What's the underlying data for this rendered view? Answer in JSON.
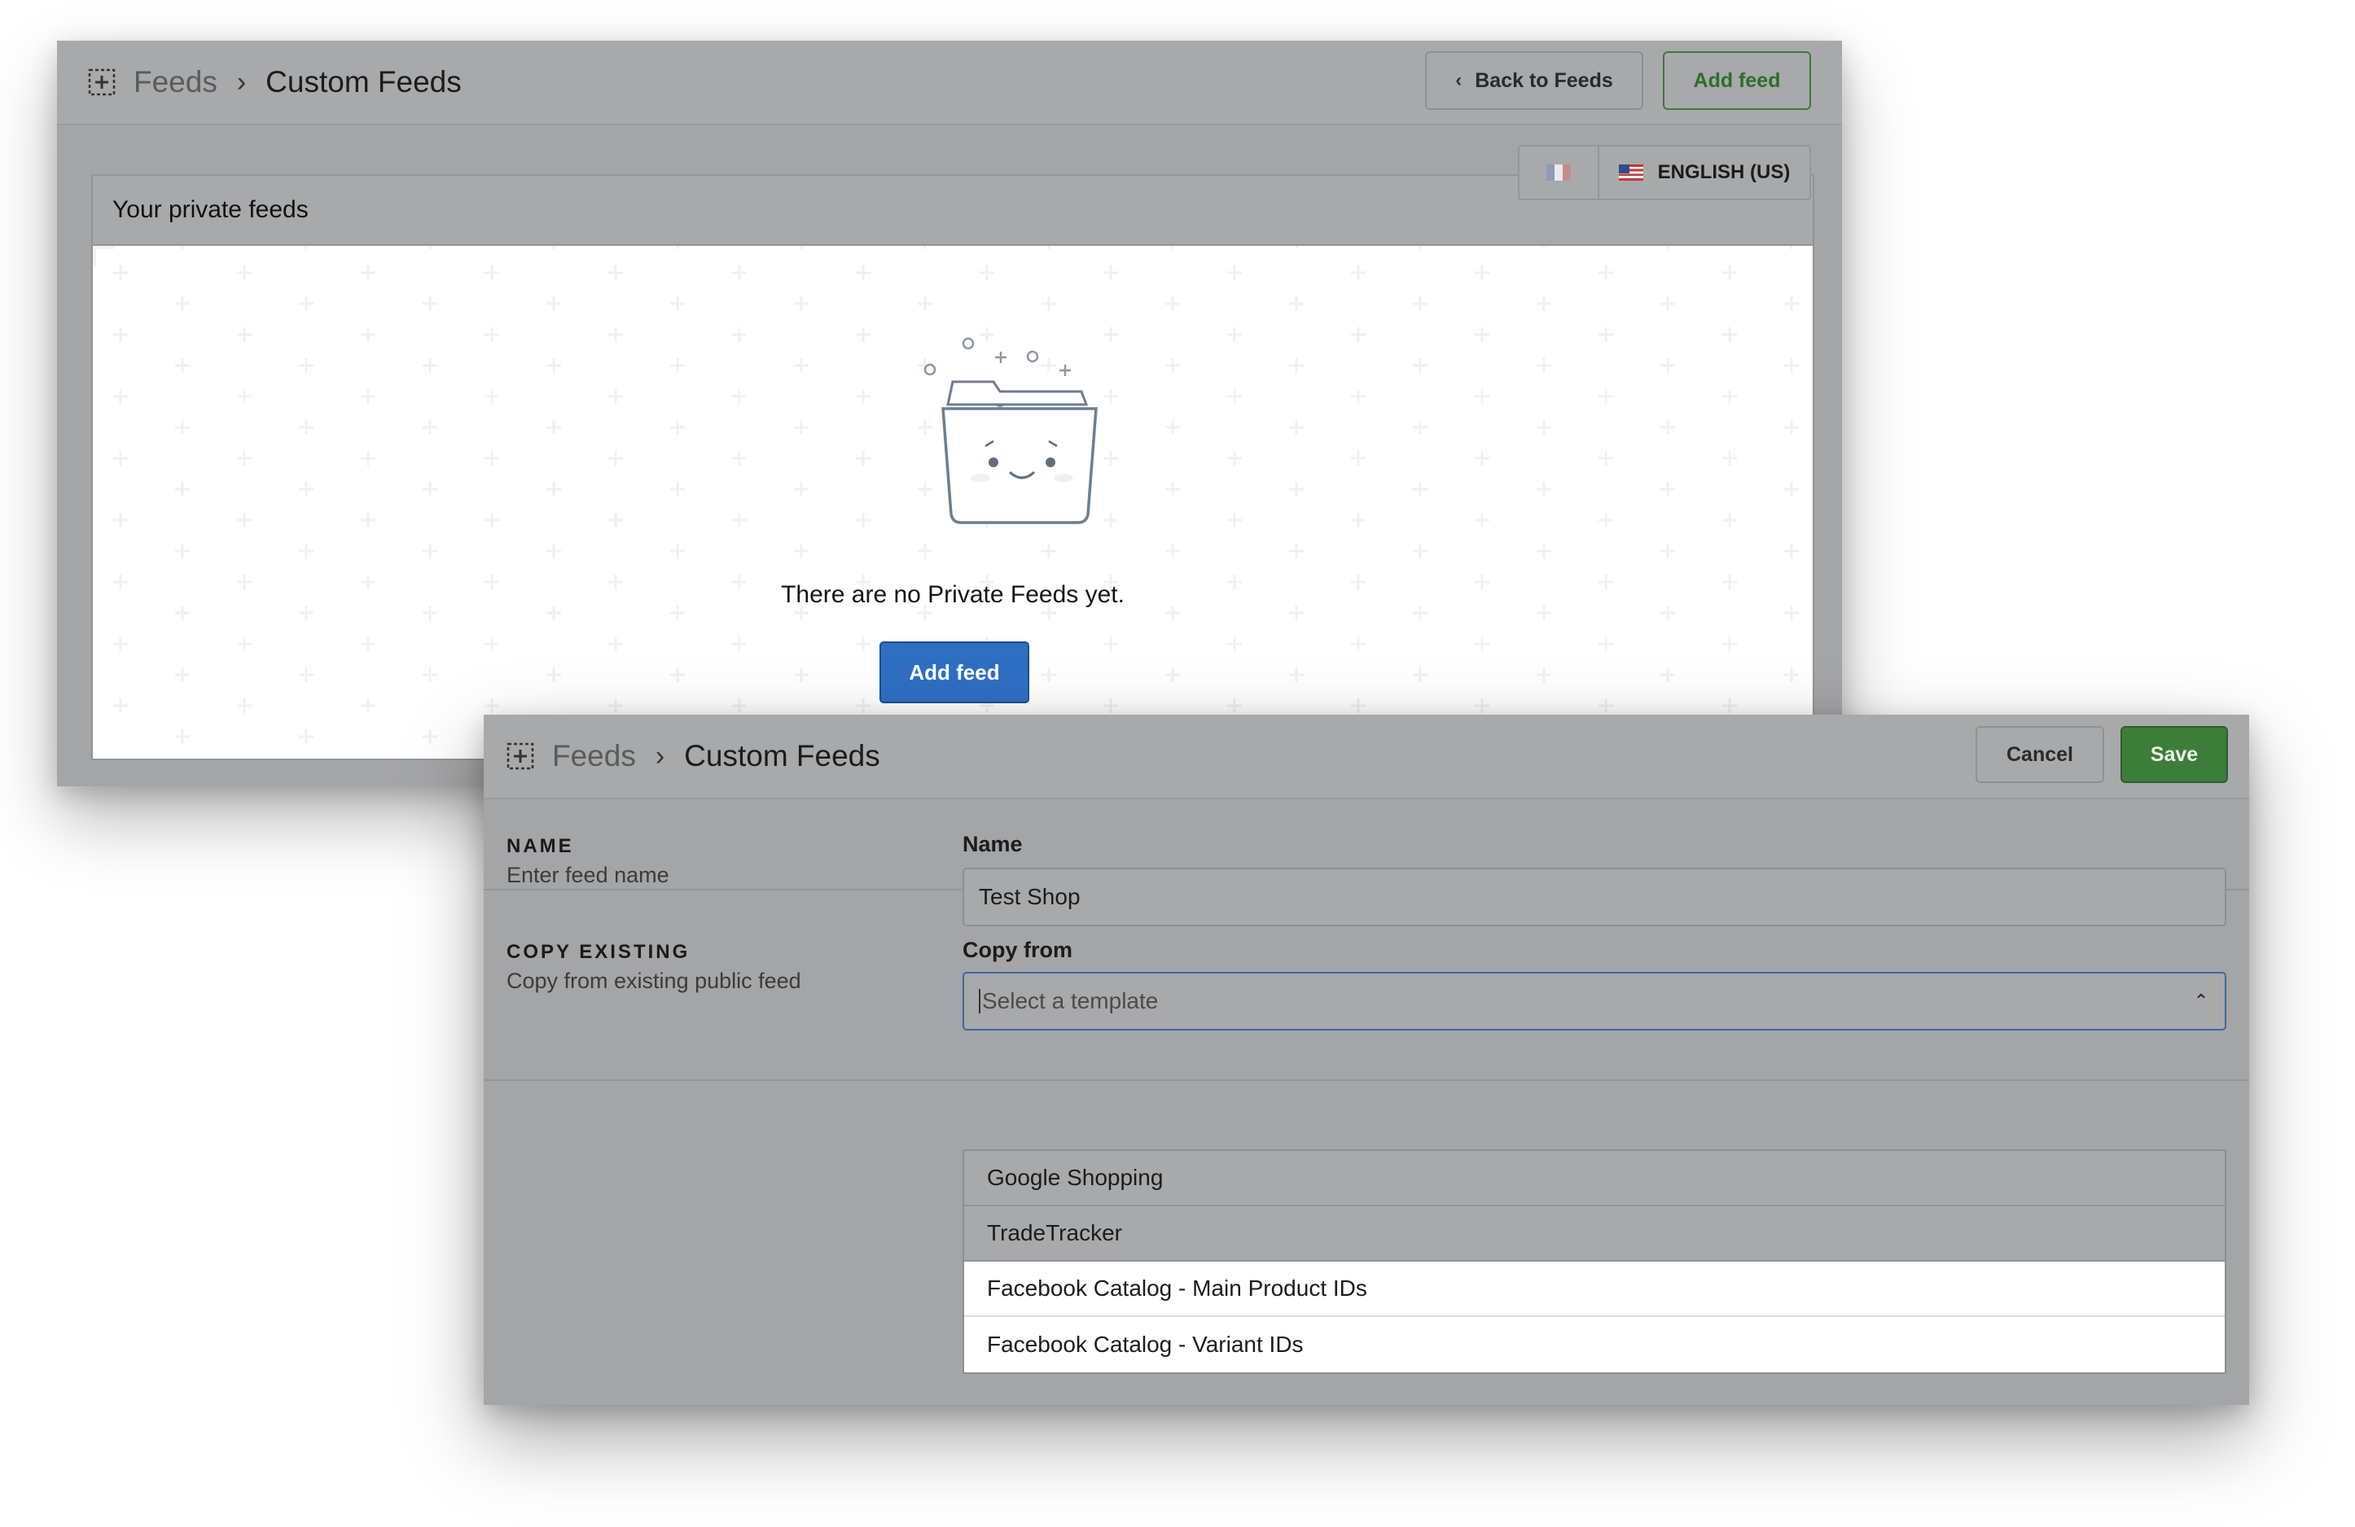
{
  "back_window": {
    "breadcrumb": {
      "root": "Feeds",
      "separator": "›",
      "current": "Custom Feeds"
    },
    "buttons": {
      "back_to_feeds": "Back to Feeds",
      "back_chevron": "‹",
      "add_feed": "Add feed"
    },
    "language": {
      "current": "ENGLISH (US)",
      "icons": [
        "flag-fr-icon",
        "flag-us-icon"
      ]
    },
    "panel": {
      "title": "Your private feeds",
      "empty_message": "There are no Private Feeds yet.",
      "add_feed_label": "Add feed"
    }
  },
  "front_window": {
    "breadcrumb": {
      "root": "Feeds",
      "separator": "›",
      "current": "Custom Feeds"
    },
    "buttons": {
      "cancel": "Cancel",
      "save": "Save"
    },
    "name_section": {
      "heading": "NAME",
      "description": "Enter feed name",
      "field_label": "Name",
      "field_value": "Test Shop"
    },
    "copy_section": {
      "heading": "COPY EXISTING",
      "description": "Copy from existing public feed",
      "field_label": "Copy from",
      "placeholder": "Select a template",
      "caret": "⌃",
      "options": [
        "Google Shopping",
        "TradeTracker",
        "Facebook Catalog - Main Product IDs",
        "Facebook Catalog - Variant IDs"
      ]
    }
  },
  "colors": {
    "primary_blue": "#2f6fc2",
    "save_green": "#3c7d3a",
    "overlay_gray": "#a4a5a6"
  }
}
